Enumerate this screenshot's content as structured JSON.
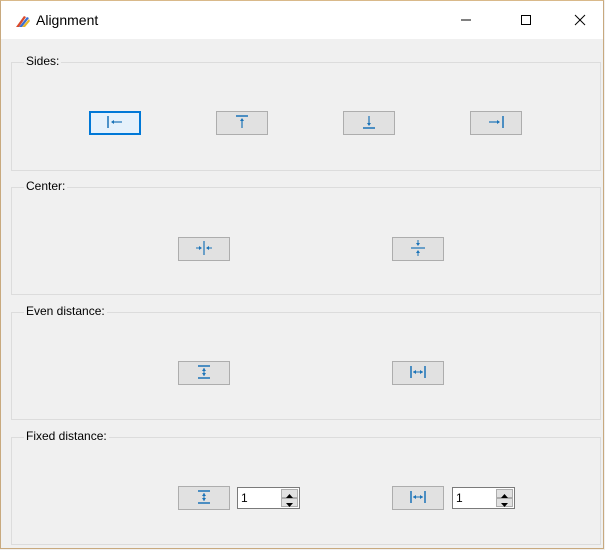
{
  "window": {
    "title": "Alignment",
    "controls": {
      "minimize": "minimize-icon",
      "maximize": "maximize-icon",
      "close": "close-icon"
    }
  },
  "groups": {
    "sides": {
      "label": "Sides:",
      "buttons": [
        "align-left-icon",
        "align-top-icon",
        "align-bottom-icon",
        "align-right-icon"
      ]
    },
    "center": {
      "label": "Center:",
      "buttons": [
        "center-horizontal-icon",
        "center-vertical-icon"
      ]
    },
    "even": {
      "label": "Even distance:",
      "buttons": [
        "distribute-vertical-icon",
        "distribute-horizontal-icon"
      ]
    },
    "fixed": {
      "label": "Fixed distance:",
      "buttons": [
        "fixed-vertical-icon",
        "fixed-horizontal-icon"
      ],
      "vertical_value": "1",
      "horizontal_value": "1"
    }
  },
  "colors": {
    "accent": "#0078d7",
    "icon": "#1a73b8"
  }
}
